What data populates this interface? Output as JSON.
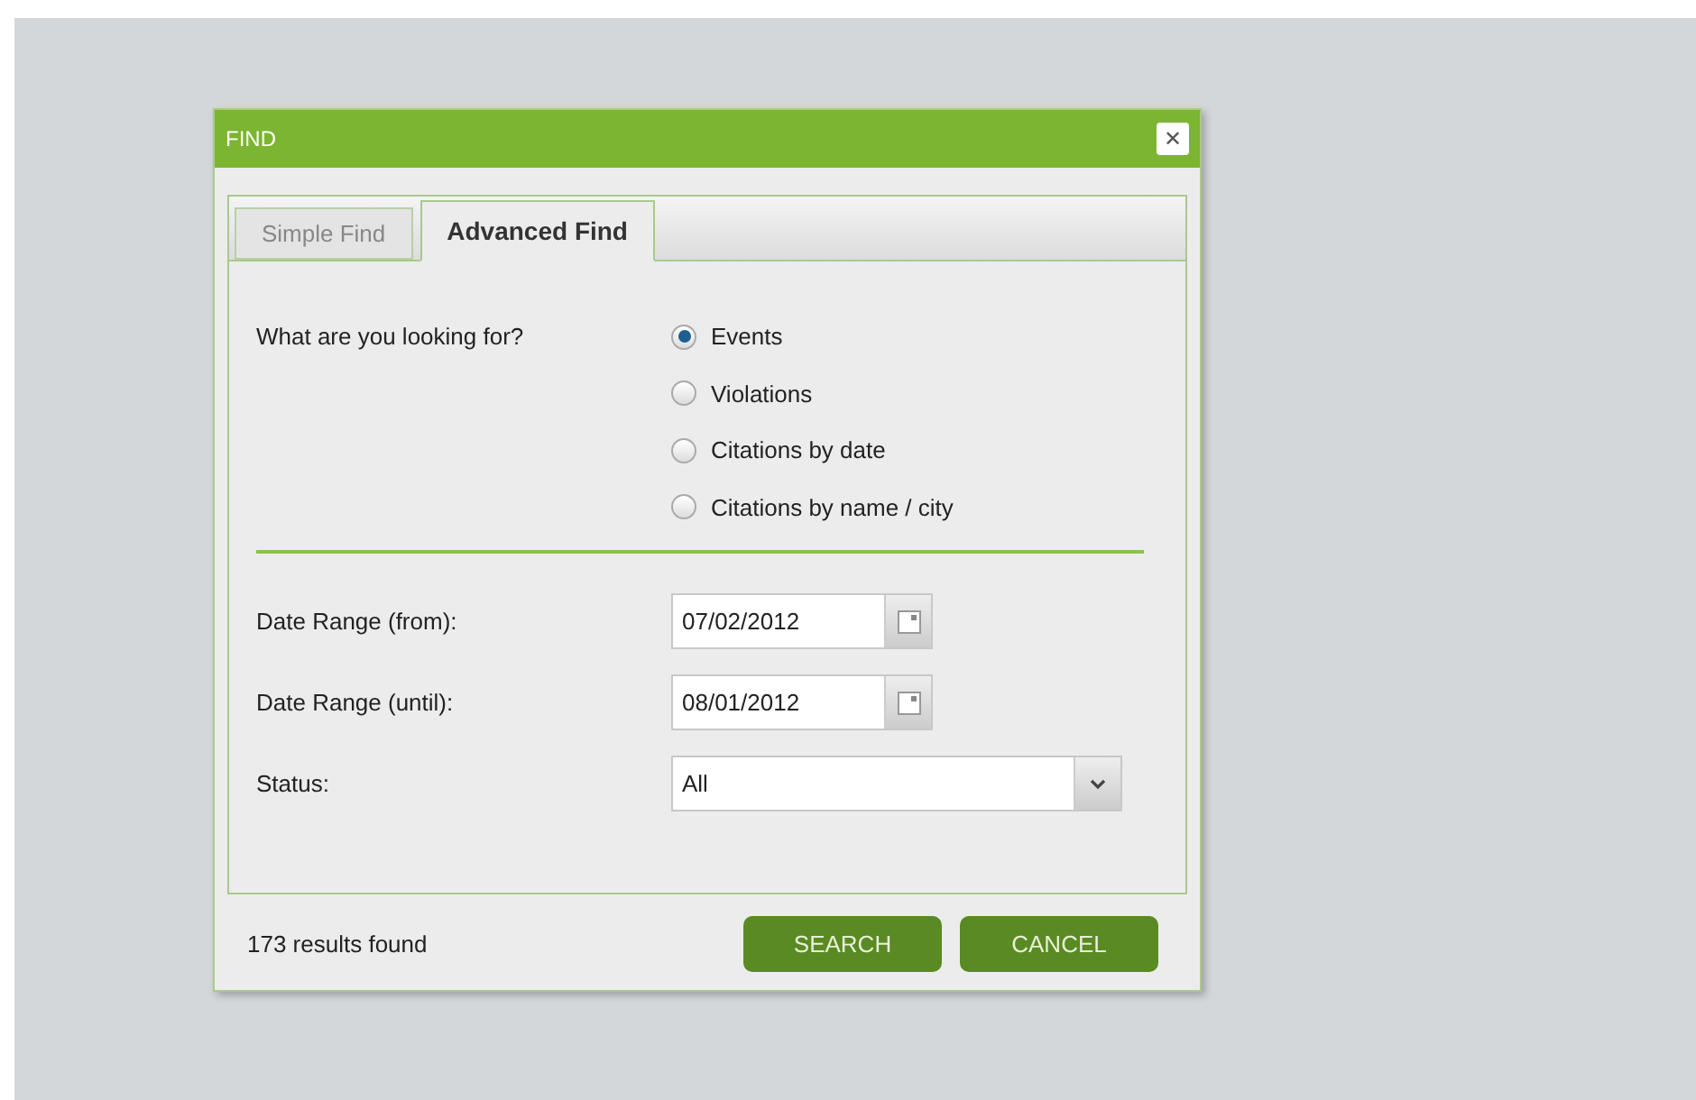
{
  "window": {
    "title": "FIND",
    "close": "✕"
  },
  "tabs": [
    {
      "label": "Simple Find",
      "selected": false
    },
    {
      "label": "Advanced Find",
      "selected": true
    }
  ],
  "question": {
    "label": "What are you looking for?",
    "options": [
      {
        "label": "Events",
        "selected": true
      },
      {
        "label": "Violations",
        "selected": false
      },
      {
        "label": "Citations by date",
        "selected": false
      },
      {
        "label": "Citations by name / city",
        "selected": false
      }
    ]
  },
  "fields": [
    {
      "kind": "date",
      "label": "Date Range (from):",
      "value": "07/02/2012"
    },
    {
      "kind": "date",
      "label": "Date Range (until):",
      "value": "08/01/2012"
    },
    {
      "kind": "select",
      "label": "Status:",
      "value": "All"
    }
  ],
  "status_bar": {
    "results": "173 results found"
  },
  "buttons": [
    "SEARCH",
    "CANCEL"
  ]
}
